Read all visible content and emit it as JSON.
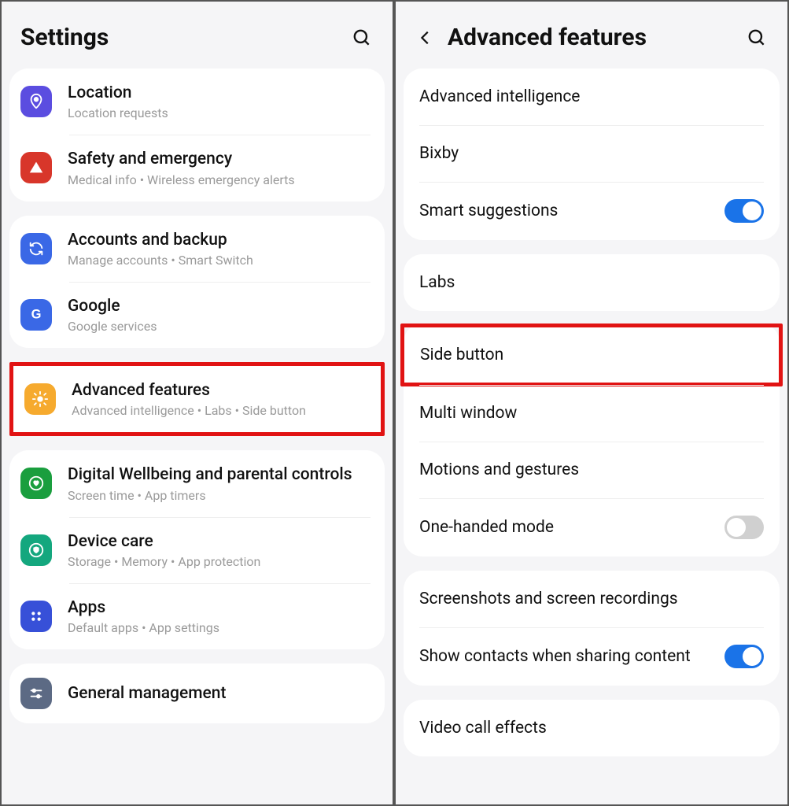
{
  "left": {
    "title": "Settings",
    "groups": [
      {
        "items": [
          {
            "id": "location",
            "icon": "location-icon",
            "iconClass": "ic-location",
            "title": "Location",
            "sub": "Location requests"
          },
          {
            "id": "safety",
            "icon": "safety-icon",
            "iconClass": "ic-safety",
            "title": "Safety and emergency",
            "sub": "Medical info  •  Wireless emergency alerts"
          }
        ]
      },
      {
        "items": [
          {
            "id": "accounts",
            "icon": "sync-icon",
            "iconClass": "ic-accounts",
            "title": "Accounts and backup",
            "sub": "Manage accounts  •  Smart Switch"
          },
          {
            "id": "google",
            "icon": "google-icon",
            "iconClass": "ic-google",
            "title": "Google",
            "sub": "Google services"
          }
        ]
      },
      {
        "highlighted": true,
        "items": [
          {
            "id": "advanced",
            "icon": "gear-icon",
            "iconClass": "ic-advanced",
            "title": "Advanced features",
            "sub": "Advanced intelligence  •  Labs  •  Side button"
          }
        ]
      },
      {
        "items": [
          {
            "id": "wellbeing",
            "icon": "heart-icon",
            "iconClass": "ic-wellbeing",
            "title": "Digital Wellbeing and parental controls",
            "sub": "Screen time  •  App timers"
          },
          {
            "id": "devicecare",
            "icon": "shield-icon",
            "iconClass": "ic-device",
            "title": "Device care",
            "sub": "Storage  •  Memory  •  App protection"
          },
          {
            "id": "apps",
            "icon": "grid-icon",
            "iconClass": "ic-apps",
            "title": "Apps",
            "sub": "Default apps  •  App settings"
          }
        ]
      },
      {
        "items": [
          {
            "id": "general",
            "icon": "sliders-icon",
            "iconClass": "ic-general",
            "title": "General management",
            "sub": ""
          }
        ]
      }
    ]
  },
  "right": {
    "title": "Advanced features",
    "groups": [
      {
        "items": [
          {
            "id": "ai",
            "title": "Advanced intelligence"
          },
          {
            "id": "bixby",
            "title": "Bixby"
          },
          {
            "id": "smart",
            "title": "Smart suggestions",
            "toggle": "on"
          }
        ]
      },
      {
        "items": [
          {
            "id": "labs",
            "title": "Labs"
          }
        ]
      },
      {
        "items": [
          {
            "id": "side",
            "title": "Side button",
            "highlighted": true
          },
          {
            "id": "multiwin",
            "title": "Multi window"
          },
          {
            "id": "motions",
            "title": "Motions and gestures"
          },
          {
            "id": "onehand",
            "title": "One-handed mode",
            "toggle": "off"
          }
        ]
      },
      {
        "items": [
          {
            "id": "screenshots",
            "title": "Screenshots and screen recordings"
          },
          {
            "id": "sharecontacts",
            "title": "Show contacts when sharing content",
            "toggle": "on"
          }
        ]
      },
      {
        "items": [
          {
            "id": "videocall",
            "title": "Video call effects"
          }
        ]
      }
    ]
  }
}
